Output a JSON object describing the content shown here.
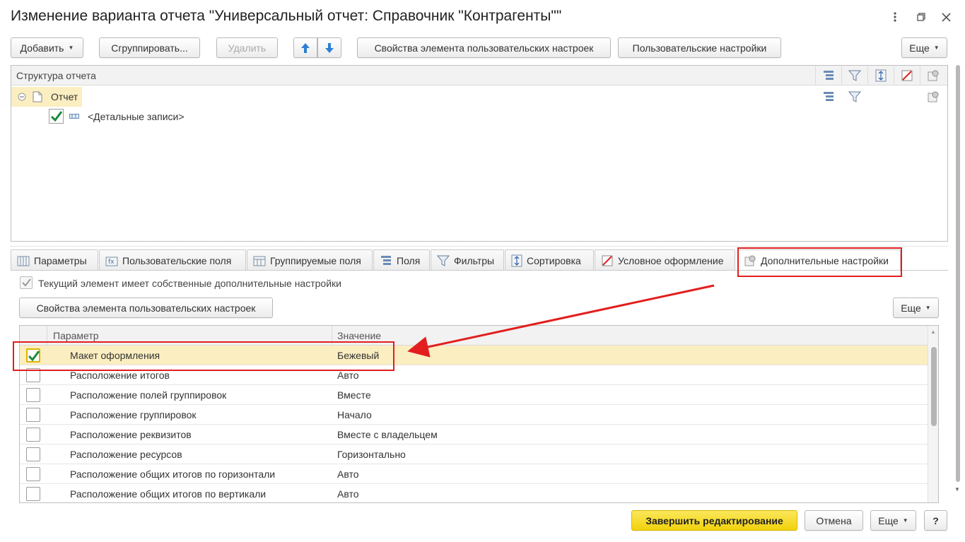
{
  "window": {
    "title": "Изменение варианта отчета \"Универсальный отчет: Справочник \"Контрагенты\"\""
  },
  "toolbar": {
    "add_label": "Добавить",
    "group_label": "Сгруппировать...",
    "delete_label": "Удалить",
    "props_label": "Свойства элемента пользовательских настроек",
    "user_settings_label": "Пользовательские настройки",
    "more_label": "Еще"
  },
  "structure": {
    "header": "Структура отчета",
    "root_label": "Отчет",
    "child_label": "<Детальные записи>"
  },
  "tabs": [
    {
      "label": "Параметры"
    },
    {
      "label": "Пользовательские поля"
    },
    {
      "label": "Группируемые поля"
    },
    {
      "label": "Поля"
    },
    {
      "label": "Фильтры"
    },
    {
      "label": "Сортировка"
    },
    {
      "label": "Условное оформление"
    },
    {
      "label": "Дополнительные настройки"
    }
  ],
  "extra": {
    "own_settings_label": "Текущий элемент имеет собственные дополнительные настройки",
    "props_button": "Свойства элемента пользовательских настроек",
    "more_label": "Еще"
  },
  "grid": {
    "col_param": "Параметр",
    "col_value": "Значение",
    "rows": [
      {
        "name": "Макет оформления",
        "value": "Бежевый",
        "checked": true
      },
      {
        "name": "Расположение итогов",
        "value": "Авто",
        "checked": false
      },
      {
        "name": "Расположение полей группировок",
        "value": "Вместе",
        "checked": false
      },
      {
        "name": "Расположение группировок",
        "value": "Начало",
        "checked": false
      },
      {
        "name": "Расположение реквизитов",
        "value": "Вместе с владельцем",
        "checked": false
      },
      {
        "name": "Расположение ресурсов",
        "value": "Горизонтально",
        "checked": false
      },
      {
        "name": "Расположение общих итогов по горизонтали",
        "value": "Авто",
        "checked": false
      },
      {
        "name": "Расположение общих итогов по вертикали",
        "value": "Авто",
        "checked": false
      }
    ]
  },
  "footer": {
    "finish_label": "Завершить редактирование",
    "cancel_label": "Отмена",
    "more_label": "Еще",
    "help_label": "?"
  },
  "colors": {
    "accent_yellow": "#f5d712",
    "selection": "#fbeec1",
    "annotation_red": "#e31e1e",
    "check_green": "#1a8a3a"
  }
}
